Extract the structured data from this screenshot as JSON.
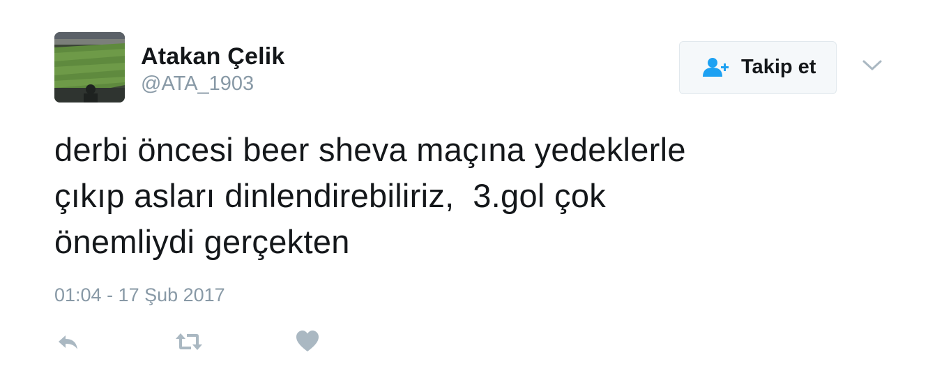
{
  "user": {
    "name": "Atakan Çelik",
    "handle": "@ATA_1903",
    "avatar_icon": "stadium-photo-avatar"
  },
  "follow_button": {
    "label": "Takip et",
    "icon": "add-user-icon",
    "accent_color": "#1da1f2"
  },
  "more_menu": {
    "icon": "chevron-down-icon"
  },
  "tweet": {
    "text": "derbi öncesi beer sheva maçına yedeklerle\nçıkıp asları dinlendirebiliriz,  3.gol çok\nönemliydi gerçekten",
    "timestamp": "01:04 - 17 Şub 2017"
  },
  "actions": [
    {
      "name": "reply",
      "icon": "reply-icon"
    },
    {
      "name": "retweet",
      "icon": "retweet-icon"
    },
    {
      "name": "like",
      "icon": "heart-icon"
    }
  ],
  "colors": {
    "text": "#14171a",
    "secondary": "#8899a6",
    "action_icons": "#aab8c2",
    "button_bg": "#f5f8fa",
    "button_border": "#e1e8ed"
  }
}
